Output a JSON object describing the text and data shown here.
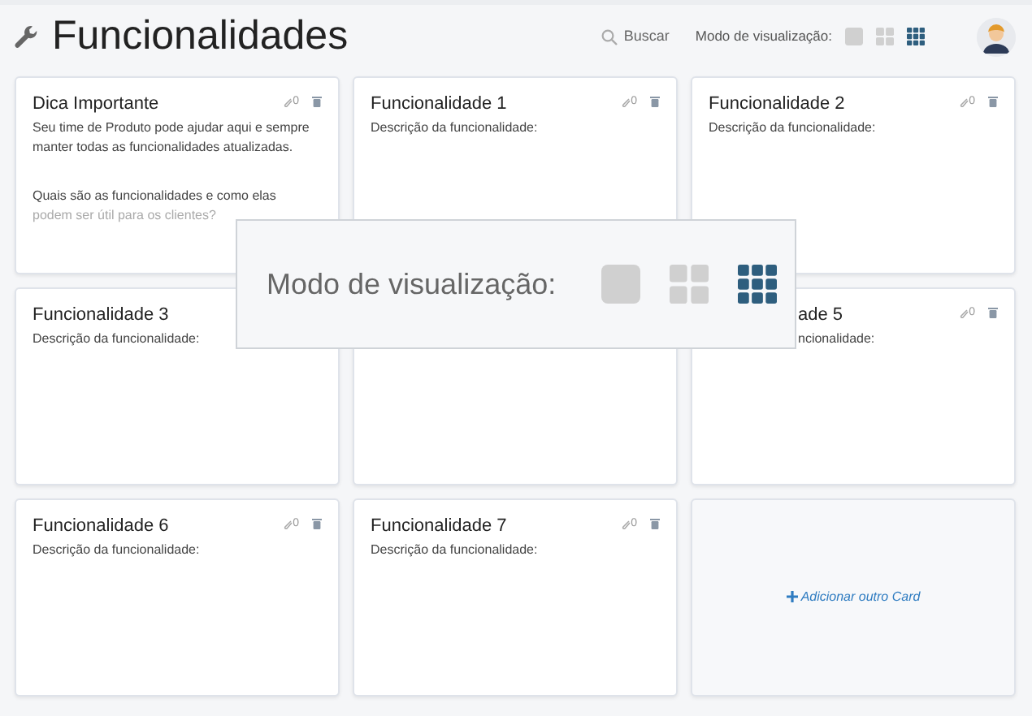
{
  "header": {
    "title": "Funcionalidades",
    "search": "Buscar",
    "view_label": "Modo de visualização:",
    "view_modes": [
      {
        "kind": "single",
        "selected": false
      },
      {
        "kind": "quad",
        "selected": false
      },
      {
        "kind": "grid",
        "selected": true
      }
    ]
  },
  "cards": [
    {
      "kind": "tip",
      "title": "Dica Importante",
      "count": "0",
      "paragraphs": [
        "Seu time de Produto pode ajudar aqui e sempre manter todas as funcionalidades atualizadas.",
        "Quais são as funcionalidades e como elas",
        "podem ser útil para os clientes?"
      ]
    },
    {
      "kind": "feature",
      "title": "Funcionalidade 1",
      "count": "0",
      "description": "Descrição da funcionalidade:"
    },
    {
      "kind": "feature",
      "title": "Funcionalidade 2",
      "count": "0",
      "description": "Descrição da funcionalidade:"
    },
    {
      "kind": "feature",
      "title": "Funcionalidade 3",
      "description": "Descrição da funcionalidade:"
    },
    {
      "kind": "covered"
    },
    {
      "kind": "partly-covered",
      "title": "ade 5",
      "count": "0",
      "description": "ncionalidade:"
    },
    {
      "kind": "feature",
      "title": "Funcionalidade 6",
      "count": "0",
      "description": "Descrição da funcionalidade:"
    },
    {
      "kind": "feature",
      "title": "Funcionalidade 7",
      "count": "0",
      "description": "Descrição da funcionalidade:"
    },
    {
      "kind": "add",
      "label": "Adicionar outro Card"
    }
  ],
  "overlay": {
    "label": "Modo de visualização:",
    "view_modes": [
      {
        "kind": "single",
        "selected": false
      },
      {
        "kind": "quad",
        "selected": false
      },
      {
        "kind": "grid",
        "selected": true
      }
    ]
  }
}
